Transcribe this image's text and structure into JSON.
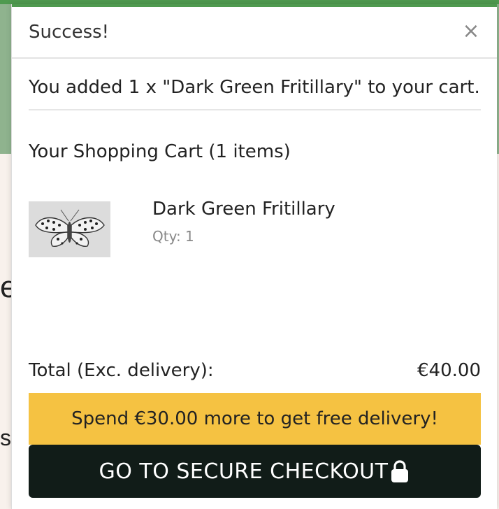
{
  "background": {
    "fragment_one": "e",
    "fragment_two": "s"
  },
  "toast": {
    "title": "Success!",
    "close_glyph": "×",
    "added_message": "You added 1 x \"Dark Green Fritillary\" to your cart."
  },
  "cart": {
    "heading": "Your Shopping Cart (1 items)",
    "items": [
      {
        "name": "Dark Green Fritillary",
        "qty_text": "Qty: 1",
        "image_icon": "butterfly-drawing"
      }
    ],
    "total_label": "Total (Exc. delivery):",
    "total_value": "€40.00",
    "delivery_notice": "Spend €30.00 more to get free delivery!",
    "checkout_label": "GO TO SECURE CHECKOUT"
  },
  "colors": {
    "accent_green": "#4f9a4f",
    "banner_yellow": "#f5c242",
    "button_dark": "#111c18"
  }
}
